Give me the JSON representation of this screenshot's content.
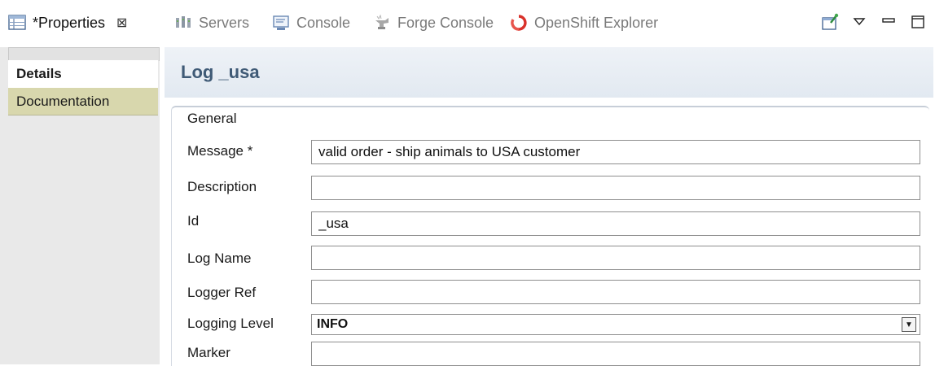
{
  "tabs": {
    "properties": {
      "label": "*Properties",
      "close": "⊠",
      "icon": "properties-table-icon"
    },
    "servers": {
      "label": "Servers",
      "icon": "servers-icon"
    },
    "console": {
      "label": "Console",
      "icon": "console-icon"
    },
    "forge": {
      "label": "Forge Console",
      "icon": "forge-icon"
    },
    "openshift": {
      "label": "OpenShift Explorer",
      "icon": "openshift-icon"
    }
  },
  "left_tabs": {
    "details": "Details",
    "documentation": "Documentation"
  },
  "main": {
    "title": "Log _usa",
    "section": "General"
  },
  "form": {
    "message": {
      "label": "Message *",
      "value": "valid order - ship animals to USA customer"
    },
    "description": {
      "label": "Description",
      "value": ""
    },
    "id": {
      "label": "Id",
      "value": "_usa"
    },
    "log_name": {
      "label": "Log Name",
      "value": ""
    },
    "logger_ref": {
      "label": "Logger Ref",
      "value": ""
    },
    "logging_level": {
      "label": "Logging Level",
      "value": "INFO"
    },
    "marker": {
      "label": "Marker",
      "value": ""
    }
  },
  "colors": {
    "accent_title": "#3f5a76",
    "documentation_tab": "#d8d7ad",
    "openshift_red": "#d9322b"
  }
}
